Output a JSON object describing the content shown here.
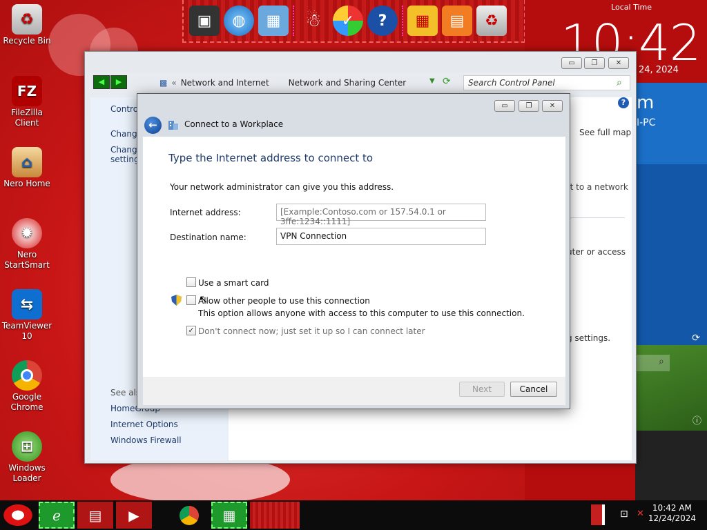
{
  "desktop": {
    "icons": [
      {
        "label": "Recycle Bin",
        "icon": "recycle-bin-icon"
      },
      {
        "label": "FileZilla Client",
        "icon": "filezilla-icon",
        "glyph": "FZ"
      },
      {
        "label": "Nero Home",
        "icon": "nero-home-icon"
      },
      {
        "label": "Nero StartSmart",
        "icon": "nero-startsmart-icon"
      },
      {
        "label": "TeamViewer 10",
        "icon": "teamviewer-icon"
      },
      {
        "label": "Google Chrome",
        "icon": "chrome-icon"
      },
      {
        "label": "Windows Loader",
        "icon": "windows-loader-icon"
      }
    ]
  },
  "clock": {
    "label": "Local Time",
    "time": "10:42",
    "date_fragment": "24, 2024",
    "tile_text_1": "m",
    "tile_text_2": "I-PC"
  },
  "cp": {
    "breadcrumb": [
      "Network and Internet",
      "Network and Sharing Center"
    ],
    "search_placeholder": "Search Control Panel",
    "left_items": [
      "Control",
      "Change",
      "Change settings"
    ],
    "see_also": "See also",
    "see_also_links": [
      "HomeGroup",
      "Internet Options",
      "Windows Firewall"
    ],
    "right_texts": [
      "See full map",
      "ct to a network",
      "uter or access",
      "g settings."
    ]
  },
  "dialog": {
    "title": "Connect to a Workplace",
    "heading": "Type the Internet address to connect to",
    "subtext": "Your network administrator can give you this address.",
    "internet_address_label": "Internet address:",
    "internet_address_placeholder": "[Example:Contoso.com or 157.54.0.1 or 3ffe:1234::1111]",
    "destination_label": "Destination name:",
    "destination_value": "VPN Connection",
    "smart_card_label": "Use a smart card",
    "allow_others_label": "Allow other people to use this connection",
    "allow_others_desc": "This option allows anyone with access to this computer to use this connection.",
    "dont_connect_label": "Don't connect now; just set it up so I can connect later",
    "next_label": "Next",
    "cancel_label": "Cancel"
  },
  "taskbar": {
    "time": "10:42 AM",
    "date": "12/24/2024"
  },
  "colors": {
    "desktop_red": "#c81616",
    "tile_blue": "#1b6fc7",
    "link_blue": "#1e3b6b"
  }
}
